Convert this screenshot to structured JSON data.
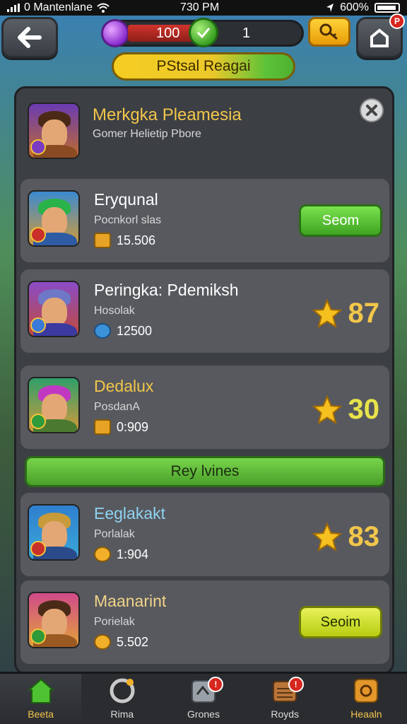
{
  "status_bar": {
    "carrier": "0 Mantenlane",
    "time": "730 PM",
    "battery": "600%"
  },
  "currency": {
    "gems": "100",
    "coins": "1"
  },
  "header_badge": "P",
  "title": "PStsal Reagai",
  "featured": {
    "name": "Merkgka Pleamesia",
    "subtitle": "Gomer Helietip Pbore"
  },
  "section_button": "Rey lvines",
  "rows": [
    {
      "name": "Eryqunal",
      "sub": "Pocnkorl slas",
      "value": "15.506",
      "action": "Seom"
    },
    {
      "name": "Peringka: Pdemiksh",
      "sub": "Hosolak",
      "value": "12500",
      "score": "87"
    },
    {
      "name": "Dedalux",
      "sub": "PosdanA",
      "value": "0:909",
      "score": "30"
    },
    {
      "name": "Eeglakakt",
      "sub": "Porlalak",
      "value": "1:904",
      "score": "83"
    },
    {
      "name": "Maanarint",
      "sub": "Porielak",
      "value": "5.502",
      "action": "Seoim"
    }
  ],
  "nav": [
    {
      "label": "Beeta",
      "badge": ""
    },
    {
      "label": "Rima",
      "badge": ""
    },
    {
      "label": "Grones",
      "badge": "!"
    },
    {
      "label": "Royds",
      "badge": "!"
    },
    {
      "label": "Heaaln",
      "badge": ""
    }
  ],
  "colors": {
    "accent_green": "#4fb031",
    "accent_yellow": "#f5cd22",
    "score_gold": "#f2c64a",
    "panel": "#3c3f44"
  }
}
